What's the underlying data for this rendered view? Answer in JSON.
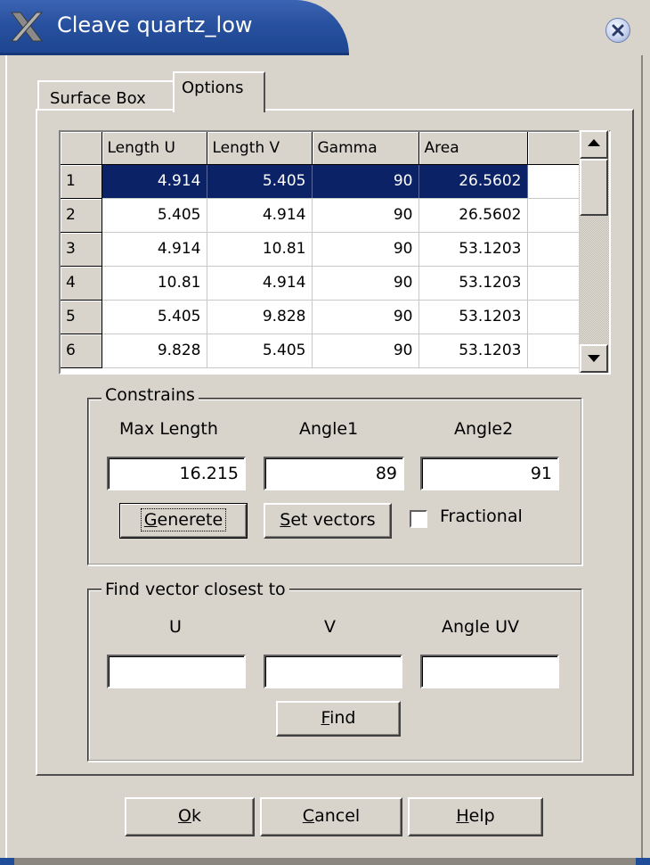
{
  "window": {
    "title": "Cleave quartz_low"
  },
  "tabs": [
    {
      "label": "Surface Box"
    },
    {
      "label": "Options"
    }
  ],
  "table": {
    "columns": [
      "Length U",
      "Length V",
      "Gamma",
      "Area"
    ],
    "rows": [
      {
        "index": "1",
        "length_u": "4.914",
        "length_v": "5.405",
        "gamma": "90",
        "area": "26.5602"
      },
      {
        "index": "2",
        "length_u": "5.405",
        "length_v": "4.914",
        "gamma": "90",
        "area": "26.5602"
      },
      {
        "index": "3",
        "length_u": "4.914",
        "length_v": "10.81",
        "gamma": "90",
        "area": "53.1203"
      },
      {
        "index": "4",
        "length_u": "10.81",
        "length_v": "4.914",
        "gamma": "90",
        "area": "53.1203"
      },
      {
        "index": "5",
        "length_u": "5.405",
        "length_v": "9.828",
        "gamma": "90",
        "area": "53.1203"
      },
      {
        "index": "6",
        "length_u": "9.828",
        "length_v": "5.405",
        "gamma": "90",
        "area": "53.1203"
      }
    ]
  },
  "constrains": {
    "legend": "Constrains",
    "max_length_label": "Max Length",
    "angle1_label": "Angle1",
    "angle2_label": "Angle2",
    "max_length_value": "16.215",
    "angle1_value": "89",
    "angle2_value": "91",
    "generate_button": {
      "mnemonic": "G",
      "rest": "enerete"
    },
    "set_vectors_button": {
      "mnemonic": "S",
      "rest": "et vectors"
    },
    "fractional_label": "Fractional"
  },
  "find": {
    "legend": "Find vector closest to",
    "u_label": "U",
    "v_label": "V",
    "angle_label": "Angle UV",
    "u_value": "",
    "v_value": "",
    "angle_value": "",
    "find_button": {
      "mnemonic": "F",
      "rest": "ind"
    }
  },
  "footer": {
    "ok_button": {
      "mnemonic": "O",
      "rest": "k"
    },
    "cancel_button": {
      "mnemonic": "C",
      "rest": "ancel"
    },
    "help_button": {
      "mnemonic": "H",
      "rest": "elp"
    }
  },
  "icons": {
    "app_icon": "x-logo-icon",
    "close_icon": "close-icon"
  }
}
